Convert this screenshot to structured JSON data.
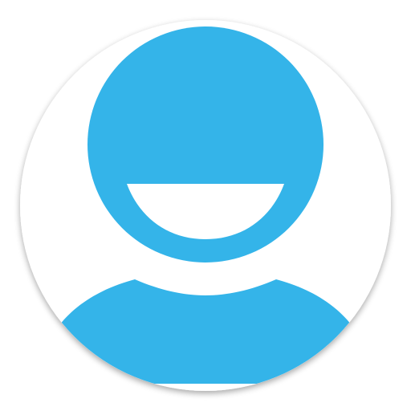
{
  "icon": {
    "name": "user-avatar-icon",
    "description_colors": {
      "primary": "#34B4E9",
      "background": "#FFFFFF",
      "shadow": "#9E9E9E"
    }
  }
}
